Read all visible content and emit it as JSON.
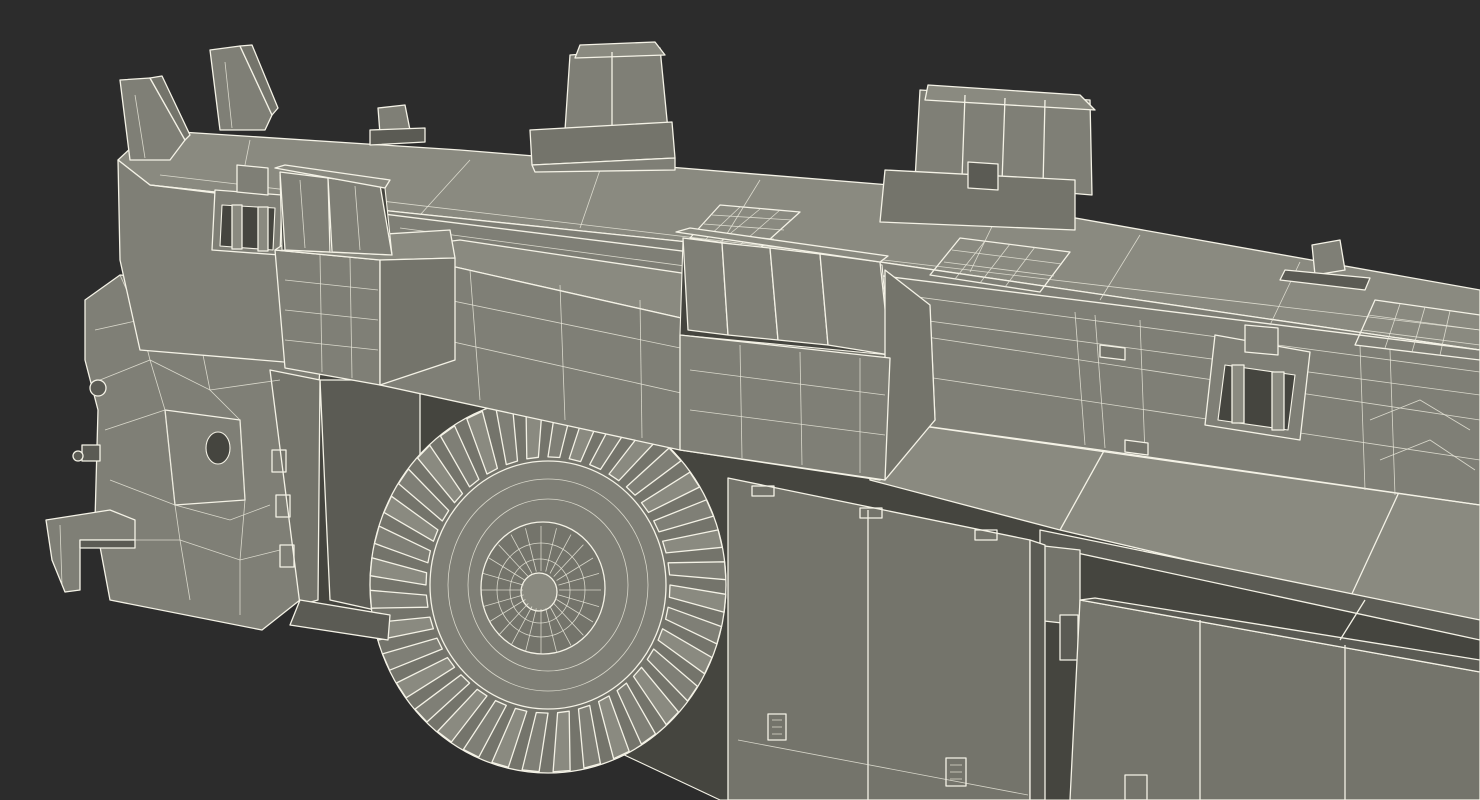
{
  "scene": {
    "background_color": "#2c2c2c",
    "material_color": "#7f7f76",
    "wire_color": "#f4f2e6"
  }
}
